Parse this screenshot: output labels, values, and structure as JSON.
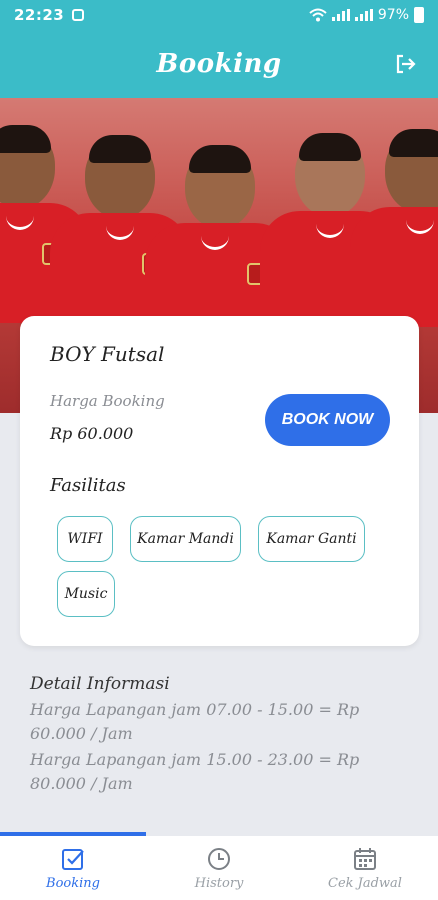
{
  "status_bar": {
    "time": "22:23",
    "battery": "97%"
  },
  "header": {
    "title": "Booking"
  },
  "booking_card": {
    "venue_name": "BOY Futsal",
    "price_label": "Harga Booking",
    "price_value": "Rp 60.000",
    "book_button": "BOOK NOW",
    "facilities_label": "Fasilitas",
    "facilities": [
      "WIFI",
      "Kamar Mandi",
      "Kamar Ganti",
      "Music"
    ]
  },
  "detail": {
    "heading": "Detail Informasi",
    "lines": [
      "Harga Lapangan jam 07.00 - 15.00 = Rp 60.000 / Jam",
      "Harga Lapangan jam 15.00 - 23.00 = Rp 80.000 / Jam"
    ]
  },
  "bottom_nav": {
    "items": [
      {
        "label": "Booking",
        "icon": "checkbox-icon"
      },
      {
        "label": "History",
        "icon": "clock-icon"
      },
      {
        "label": "Cek Jadwal",
        "icon": "calendar-icon"
      }
    ]
  },
  "colors": {
    "primary": "#3bbcc8",
    "accent": "#2f6fe8",
    "chip_border": "#5bbfc4"
  }
}
